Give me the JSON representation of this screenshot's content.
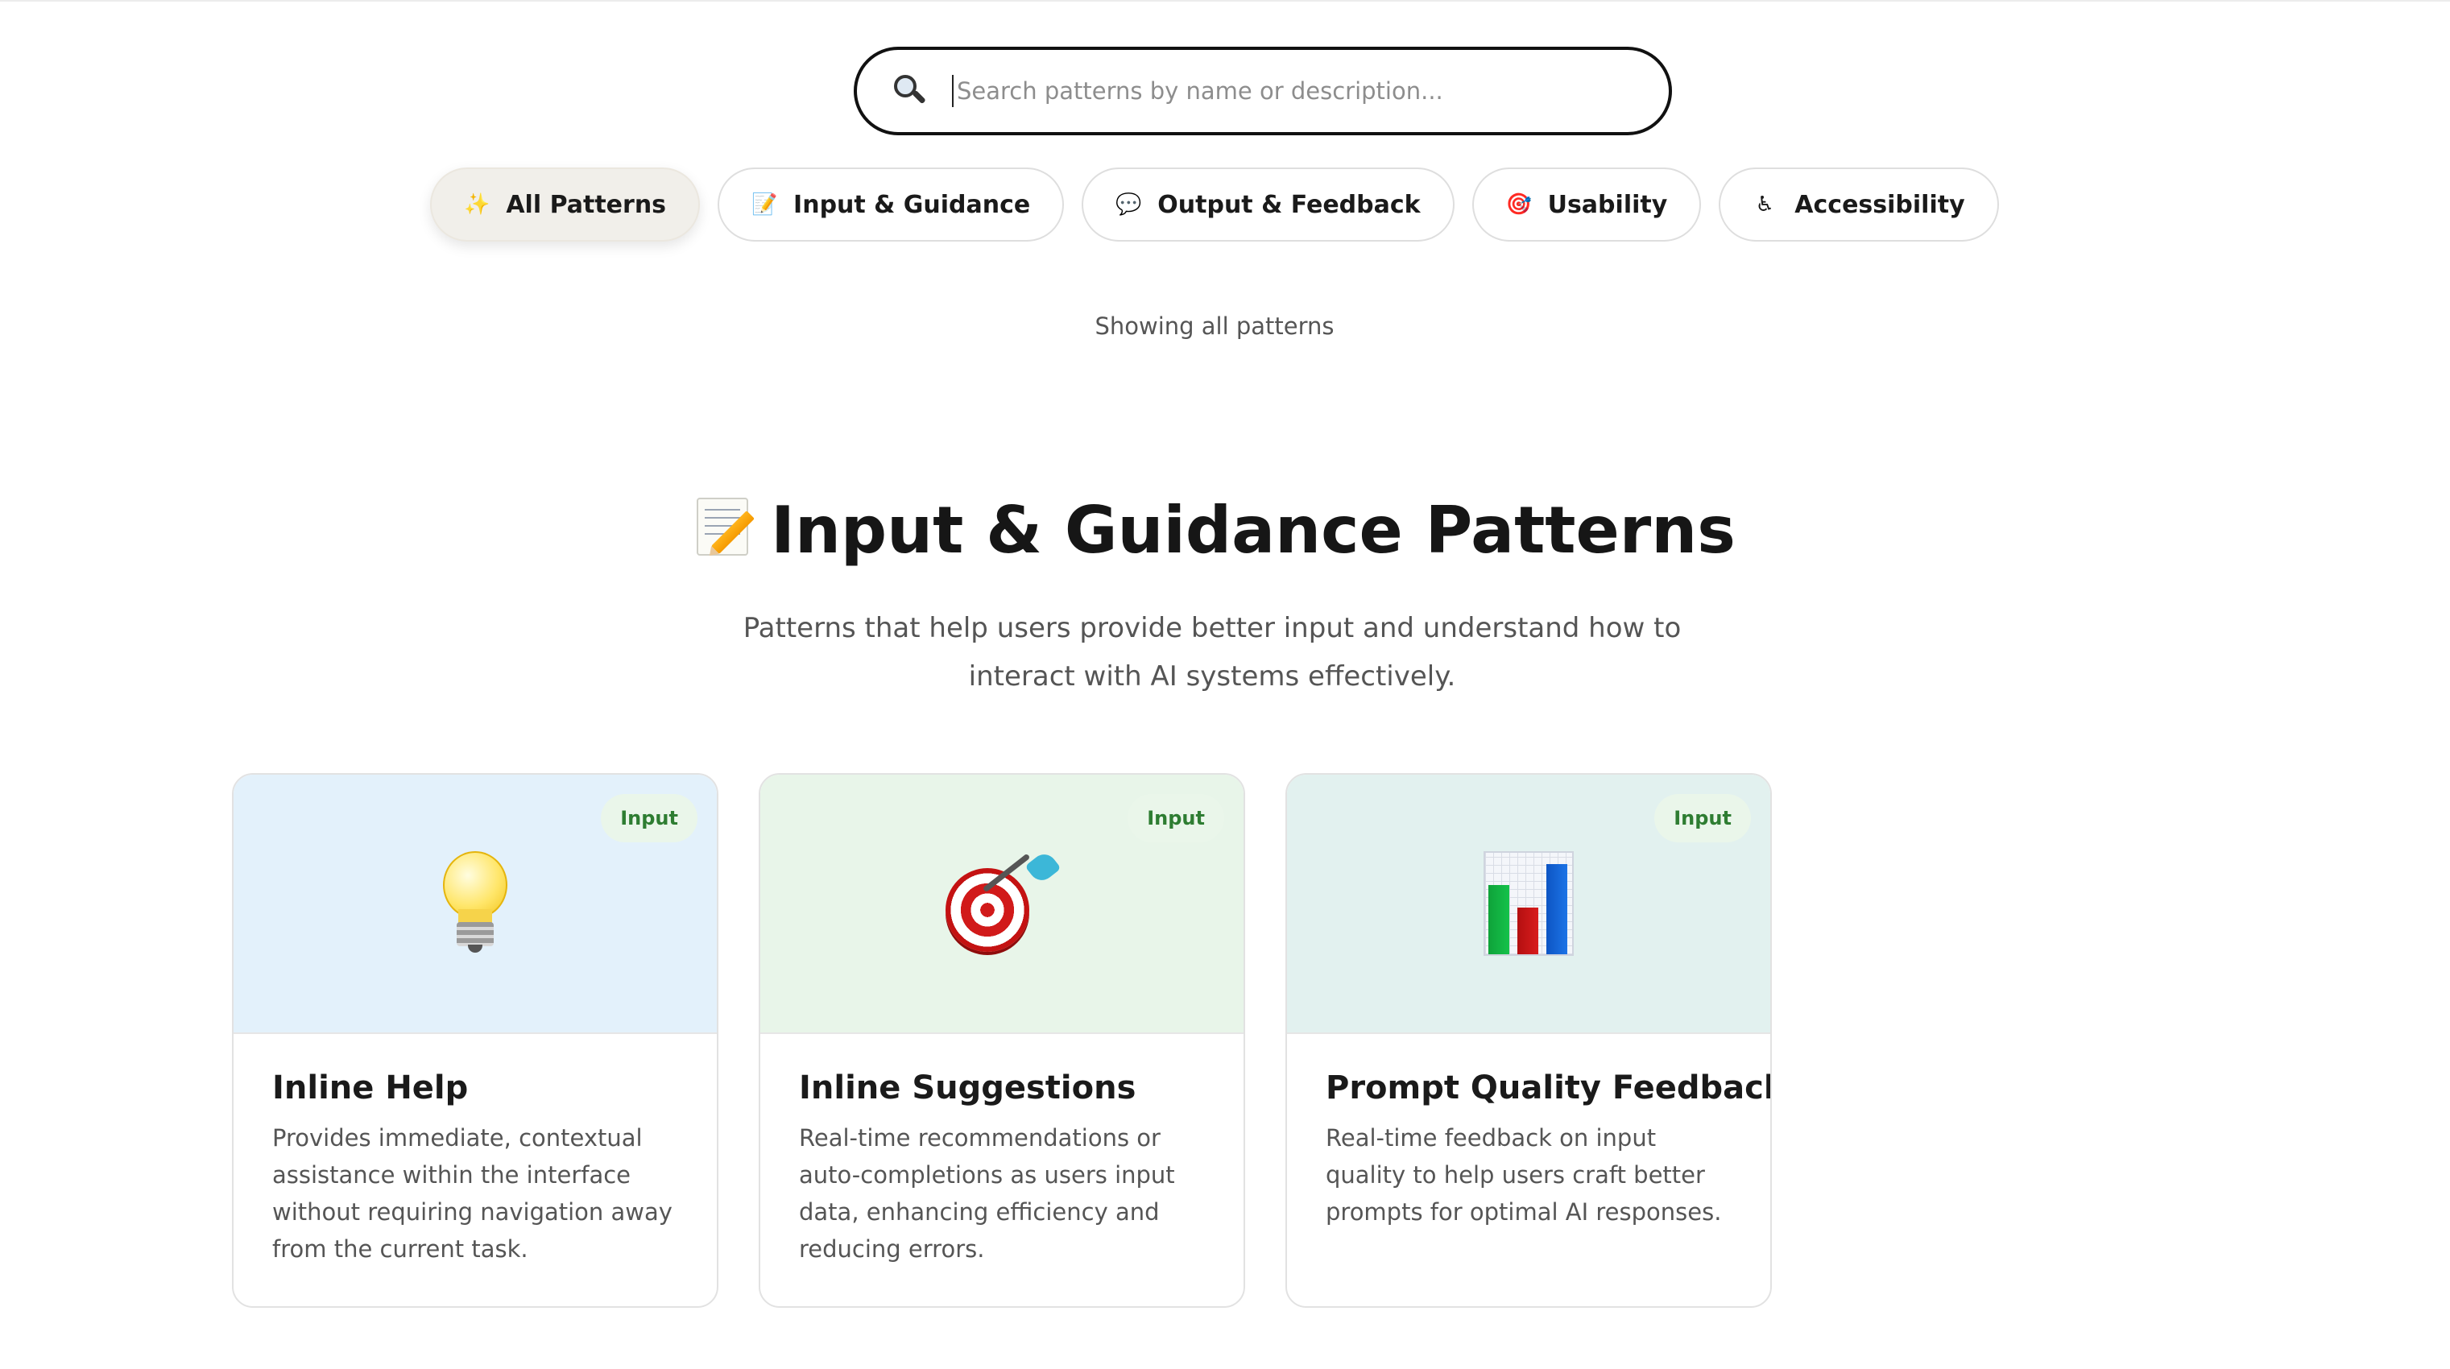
{
  "search": {
    "placeholder": "Search patterns by name or description...",
    "icon": "magnifier-icon"
  },
  "filters": [
    {
      "icon": "✨",
      "label": "All Patterns",
      "active": true
    },
    {
      "icon": "📝",
      "label": "Input & Guidance",
      "active": false
    },
    {
      "icon": "💬",
      "label": "Output & Feedback",
      "active": false
    },
    {
      "icon": "🎯",
      "label": "Usability",
      "active": false
    },
    {
      "icon": "♿",
      "label": "Accessibility",
      "active": false
    }
  ],
  "status": {
    "showing_text": "Showing all patterns"
  },
  "section": {
    "icon": "memo-icon",
    "title": "Input & Guidance Patterns",
    "description": "Patterns that help users provide better input and understand how to interact with AI systems effectively."
  },
  "cards": [
    {
      "badge": "Input",
      "title": "Inline Help",
      "description": "Provides immediate, contextual assistance within the interface without requiring navigation away from the current task.",
      "icon": "lightbulb-icon",
      "bg": "#e3f1fb"
    },
    {
      "badge": "Input",
      "title": "Inline Suggestions",
      "description": "Real-time recommendations or auto-completions as users input data, enhancing efficiency and reducing errors.",
      "icon": "target-icon",
      "bg": "#e8f5e9"
    },
    {
      "badge": "Input",
      "title": "Prompt Quality Feedback",
      "description": "Real-time feedback on input quality to help users craft better prompts for optimal AI responses.",
      "icon": "bar-chart-icon",
      "bg": "#e2f1ef"
    }
  ],
  "colors": {
    "badge_bg": "#eaf6ea",
    "badge_text": "#2e7d32",
    "active_pill_bg": "#f1efea"
  }
}
